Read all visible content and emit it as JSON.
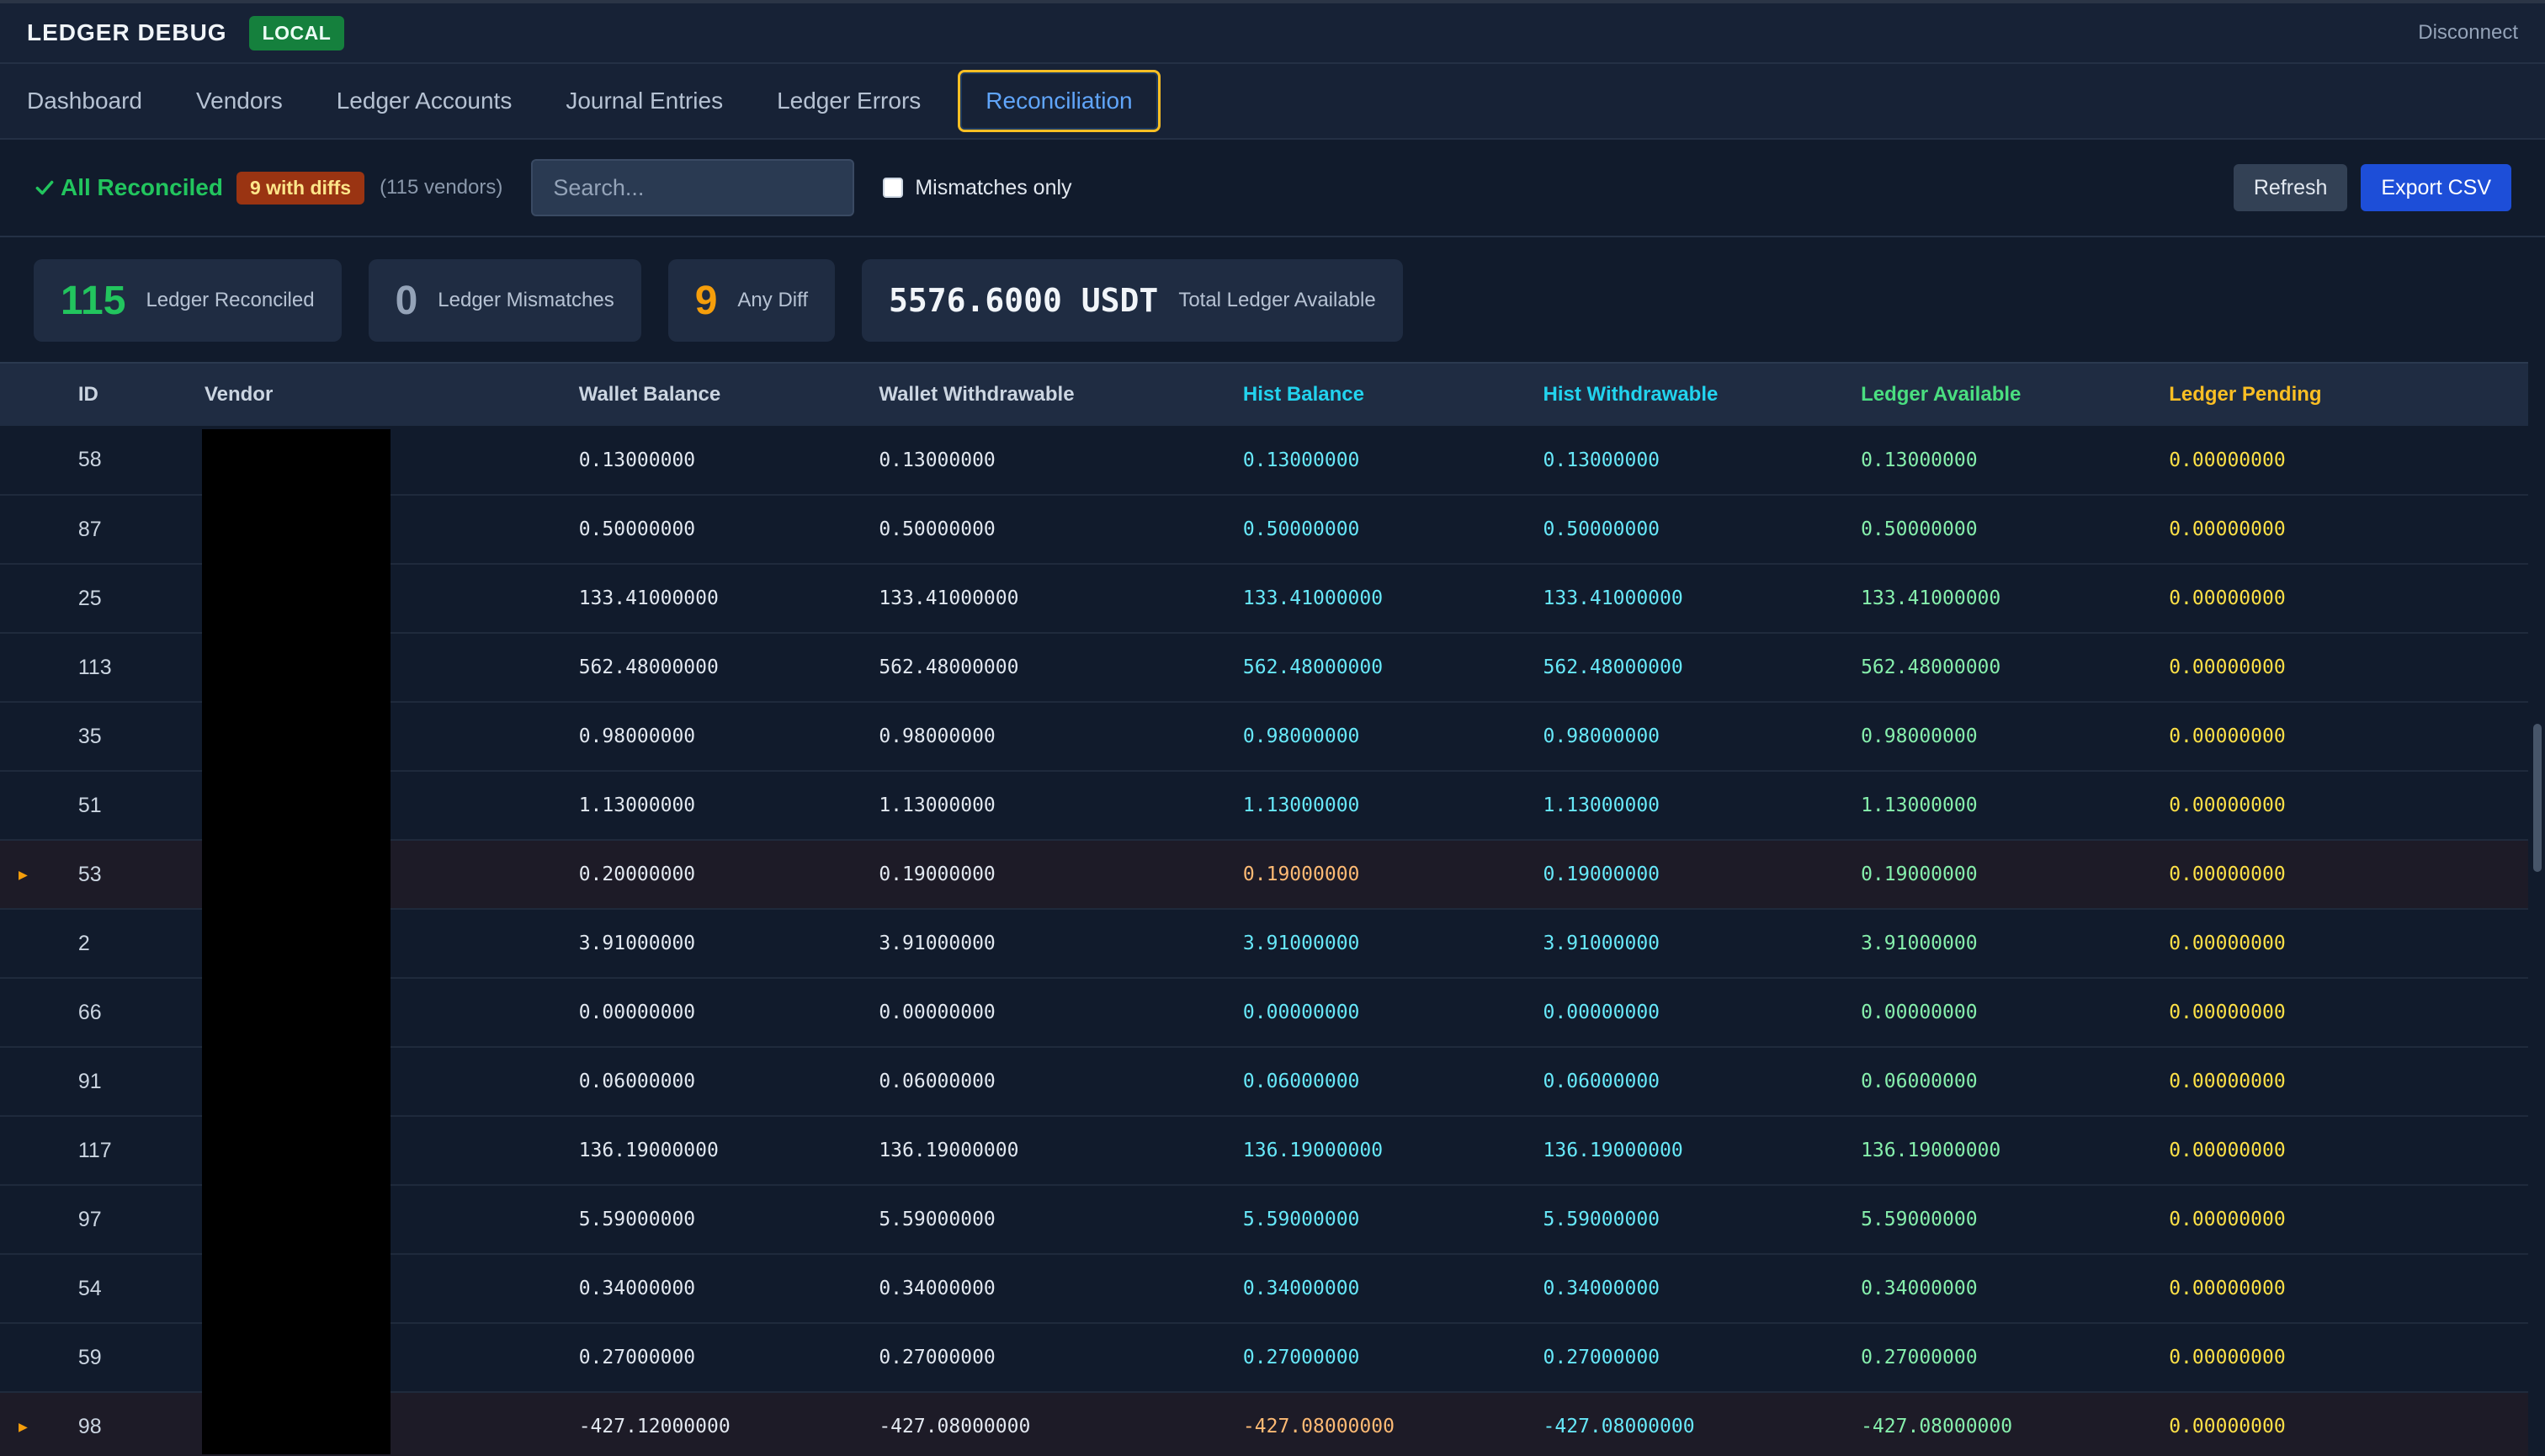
{
  "app": {
    "title": "LEDGER DEBUG",
    "env": "LOCAL",
    "disconnect": "Disconnect"
  },
  "tabs": [
    {
      "label": "Dashboard"
    },
    {
      "label": "Vendors"
    },
    {
      "label": "Ledger Accounts"
    },
    {
      "label": "Journal Entries"
    },
    {
      "label": "Ledger Errors"
    },
    {
      "label": "Reconciliation",
      "active": true
    }
  ],
  "toolbar": {
    "status": "All Reconciled",
    "diff_badge": "9 with diffs",
    "vendor_count": "(115 vendors)",
    "search_placeholder": "Search...",
    "mismatches_label": "Mismatches only",
    "refresh": "Refresh",
    "export": "Export CSV"
  },
  "stats": [
    {
      "value": "115",
      "label": "Ledger Reconciled"
    },
    {
      "value": "0",
      "label": "Ledger Mismatches"
    },
    {
      "value": "9",
      "label": "Any Diff"
    },
    {
      "value": "5576.6000 USDT",
      "label": "Total Ledger Available"
    }
  ],
  "table": {
    "headers": [
      "ID",
      "Vendor",
      "Wallet Balance",
      "Wallet Withdrawable",
      "Hist Balance",
      "Hist Withdrawable",
      "Ledger Available",
      "Ledger Pending"
    ],
    "rows": [
      {
        "id": "58",
        "wb": "0.13000000",
        "ww": "0.13000000",
        "hb": "0.13000000",
        "hw": "0.13000000",
        "la": "0.13000000",
        "lp": "0.00000000"
      },
      {
        "id": "87",
        "wb": "0.50000000",
        "ww": "0.50000000",
        "hb": "0.50000000",
        "hw": "0.50000000",
        "la": "0.50000000",
        "lp": "0.00000000"
      },
      {
        "id": "25",
        "wb": "133.41000000",
        "ww": "133.41000000",
        "hb": "133.41000000",
        "hw": "133.41000000",
        "la": "133.41000000",
        "lp": "0.00000000"
      },
      {
        "id": "113",
        "wb": "562.48000000",
        "ww": "562.48000000",
        "hb": "562.48000000",
        "hw": "562.48000000",
        "la": "562.48000000",
        "lp": "0.00000000"
      },
      {
        "id": "35",
        "wb": "0.98000000",
        "ww": "0.98000000",
        "hb": "0.98000000",
        "hw": "0.98000000",
        "la": "0.98000000",
        "lp": "0.00000000"
      },
      {
        "id": "51",
        "wb": "1.13000000",
        "ww": "1.13000000",
        "hb": "1.13000000",
        "hw": "1.13000000",
        "la": "1.13000000",
        "lp": "0.00000000"
      },
      {
        "id": "53",
        "wb": "0.20000000",
        "ww": "0.19000000",
        "hb": "0.19000000",
        "hw": "0.19000000",
        "la": "0.19000000",
        "lp": "0.00000000",
        "diff": true
      },
      {
        "id": "2",
        "wb": "3.91000000",
        "ww": "3.91000000",
        "hb": "3.91000000",
        "hw": "3.91000000",
        "la": "3.91000000",
        "lp": "0.00000000"
      },
      {
        "id": "66",
        "wb": "0.00000000",
        "ww": "0.00000000",
        "hb": "0.00000000",
        "hw": "0.00000000",
        "la": "0.00000000",
        "lp": "0.00000000"
      },
      {
        "id": "91",
        "wb": "0.06000000",
        "ww": "0.06000000",
        "hb": "0.06000000",
        "hw": "0.06000000",
        "la": "0.06000000",
        "lp": "0.00000000"
      },
      {
        "id": "117",
        "wb": "136.19000000",
        "ww": "136.19000000",
        "hb": "136.19000000",
        "hw": "136.19000000",
        "la": "136.19000000",
        "lp": "0.00000000"
      },
      {
        "id": "97",
        "wb": "5.59000000",
        "ww": "5.59000000",
        "hb": "5.59000000",
        "hw": "5.59000000",
        "la": "5.59000000",
        "lp": "0.00000000"
      },
      {
        "id": "54",
        "wb": "0.34000000",
        "ww": "0.34000000",
        "hb": "0.34000000",
        "hw": "0.34000000",
        "la": "0.34000000",
        "lp": "0.00000000"
      },
      {
        "id": "59",
        "wb": "0.27000000",
        "ww": "0.27000000",
        "hb": "0.27000000",
        "hw": "0.27000000",
        "la": "0.27000000",
        "lp": "0.00000000"
      },
      {
        "id": "98",
        "wb": "-427.12000000",
        "ww": "-427.08000000",
        "hb": "-427.08000000",
        "hw": "-427.08000000",
        "la": "-427.08000000",
        "lp": "0.00000000",
        "diff": true
      }
    ]
  },
  "colors": {
    "accent": "#60a5fa",
    "ok": "#22c55e",
    "warn": "#f59e0b",
    "hist": "#22d3ee"
  },
  "icons": {
    "check": "check-icon",
    "expand": "expand-arrow-icon"
  }
}
